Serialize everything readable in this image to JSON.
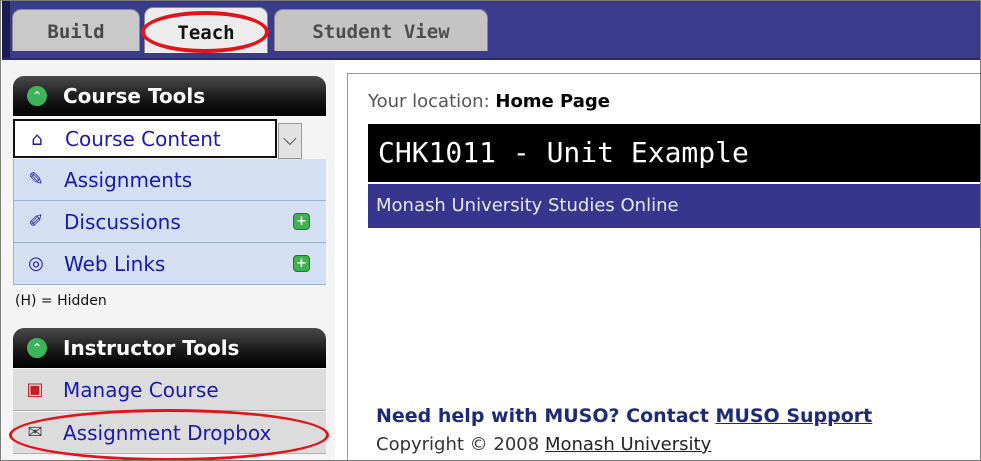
{
  "tabs": [
    {
      "label": "Build"
    },
    {
      "label": "Teach"
    },
    {
      "label": "Student View"
    }
  ],
  "course_tools": {
    "title": "Course Tools",
    "items": [
      {
        "label": "Course Content",
        "icon": "home-icon"
      },
      {
        "label": "Assignments",
        "icon": "pencil-paper-icon"
      },
      {
        "label": "Discussions",
        "icon": "pushpin-icon"
      },
      {
        "label": "Web Links",
        "icon": "globe-icon"
      }
    ],
    "hidden_note": "(H) = Hidden"
  },
  "instructor_tools": {
    "title": "Instructor Tools",
    "items": [
      {
        "label": "Manage Course",
        "icon": "toolbox-icon"
      },
      {
        "label": "Assignment Dropbox",
        "icon": "dropbox-icon"
      }
    ]
  },
  "main": {
    "location_prefix": "Your location:",
    "location": "Home Page",
    "course_title": "CHK1011 - Unit Example",
    "course_subtitle": "Monash University Studies Online",
    "help_prefix": "Need help with MUSO? Contact",
    "help_link": "MUSO Support",
    "copyright_prefix": "Copyright © 2008",
    "copyright_link": "Monash University"
  },
  "colors": {
    "tab_bar": "#3b3b8c",
    "annotation": "#e0141a",
    "subtitle_bar": "#36368e",
    "link": "#1a1ab0"
  }
}
